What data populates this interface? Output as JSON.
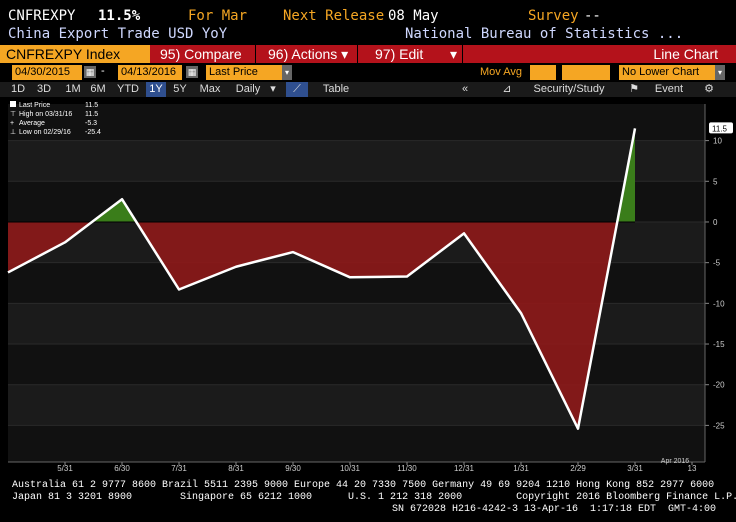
{
  "header": {
    "ticker": "CNFREXPY",
    "value": "11.5",
    "value_suffix": "%",
    "for_label": "For Mar",
    "next_release_label": "Next Release",
    "next_release_date": "08 May",
    "survey_label": "Survey",
    "survey_value": "--",
    "description": "China Export Trade USD YoY",
    "source": "National Bureau of Statistics ..."
  },
  "toolbar": {
    "index_label": "CNFREXPY Index",
    "compare_label": "95) Compare",
    "actions_label": "96) Actions ▾",
    "edit_label": "97) Edit",
    "chart_type_label": "Line Chart"
  },
  "controls": {
    "start_date": "04/30/2015",
    "end_date": "04/13/2016",
    "field": "Last Price",
    "mov_avg_label": "Mov Avg",
    "lower_chart": "No Lower Chart"
  },
  "range_bar": {
    "ranges": [
      "1D",
      "3D",
      "1M",
      "6M",
      "YTD",
      "1Y",
      "5Y",
      "Max"
    ],
    "selected": "1Y",
    "frequency": "Daily",
    "table_label": "Table",
    "back_label": "«",
    "study_label": "Security/Study",
    "event_label": "Event"
  },
  "legend": {
    "last_price_label": "Last Price",
    "last_price_value": "11.5",
    "high_label": "High on 03/31/16",
    "high_value": "11.5",
    "average_label": "Average",
    "average_value": "-5.3",
    "low_label": "Low on 02/29/16",
    "low_value": "-25.4"
  },
  "chart_data": {
    "type": "line",
    "x": [
      "2015-04-30",
      "2015-05-31",
      "2015-06-30",
      "2015-07-31",
      "2015-08-31",
      "2015-09-30",
      "2015-10-31",
      "2015-11-30",
      "2015-12-31",
      "2016-01-31",
      "2016-02-29",
      "2016-03-31"
    ],
    "values": [
      -6.2,
      -2.5,
      2.8,
      -8.3,
      -5.5,
      -3.7,
      -6.8,
      -6.7,
      -1.4,
      -11.2,
      -25.4,
      11.5
    ],
    "x_tick_labels": [
      "5/31",
      "6/30",
      "7/31",
      "8/31",
      "9/30",
      "10/31",
      "11/30",
      "12/31",
      "1/31",
      "2/29",
      "3/31",
      "13"
    ],
    "x_year_label": "Apr 2016",
    "y_ticks": [
      10,
      5,
      0,
      -5,
      -10,
      -15,
      -20,
      -25
    ],
    "ylim": [
      -29.5,
      14.5
    ],
    "last_value_label": "11.5",
    "fill_above_color": "#3a7d1a",
    "fill_below_color": "#8e1a1a",
    "line_color": "#ffffff",
    "grid": true
  },
  "footer": {
    "line1": "Australia 61 2 9777 8600 Brazil 5511 2395 9000 Europe 44 20 7330 7500 Germany 49 69 9204 1210 Hong Kong 852 2977 6000",
    "line2": "Japan 81 3 3201 8900        Singapore 65 6212 1000      U.S. 1 212 318 2000         Copyright 2016 Bloomberg Finance L.P.",
    "line3": "SN 672028 H216-4242-3 13-Apr-16  1:17:18 EDT  GMT-4:00"
  },
  "colors": {
    "accent_orange": "#f5a623",
    "toolbar_red": "#b4121b",
    "range_selected": "#2f4f8f"
  }
}
